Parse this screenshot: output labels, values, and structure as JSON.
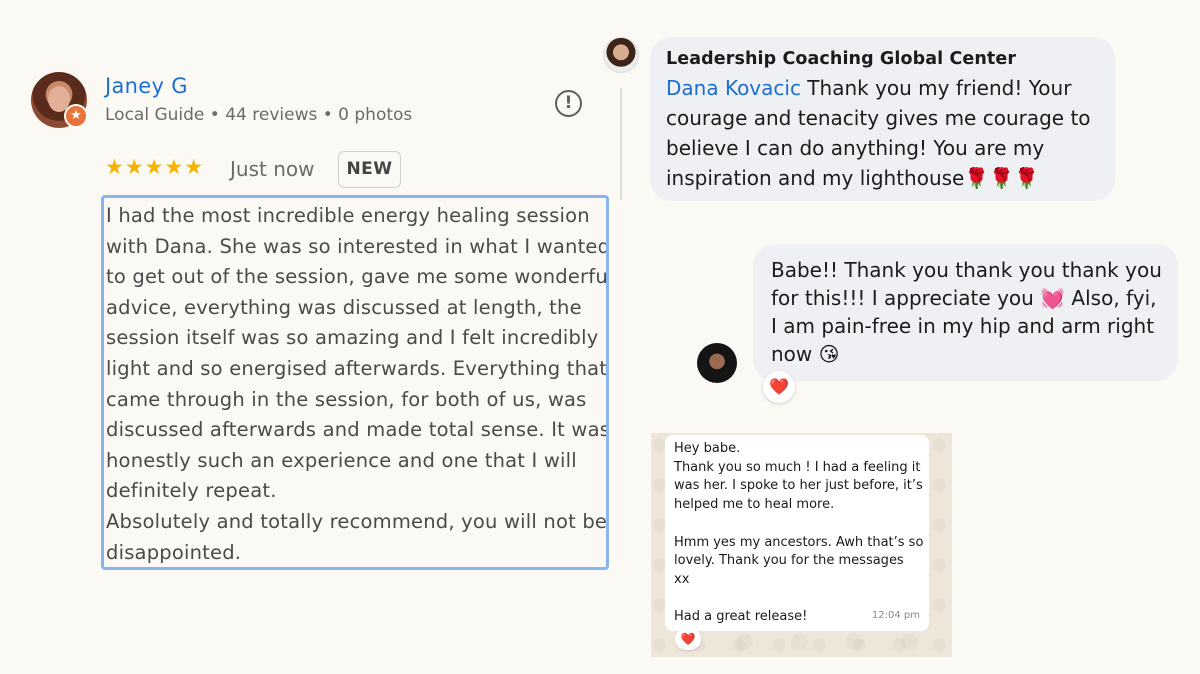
{
  "google_review": {
    "reviewer_name": "Janey G",
    "reviewer_meta": "Local Guide • 44 reviews • 0 photos",
    "guide_badge_icon": "star-icon",
    "report_icon": "report-flag-icon",
    "rating": 5,
    "stars": "★★★★★",
    "time": "Just now",
    "badge": "NEW",
    "body_lines": [
      "I had the most incredible energy healing session",
      "with Dana. She was so interested in what I wanted",
      "to get out of the session, gave me some wonderful",
      "advice, everything was discussed at length, the",
      "session itself was so amazing and I felt incredibly",
      "light and so energised afterwards. Everything that",
      "came through in the session, for both of us, was",
      "discussed afterwards and made total sense. It was",
      "honestly such an experience and one that I will",
      "definitely repeat.",
      "Absolutely and totally recommend, you will not be",
      "disappointed."
    ],
    "colors": {
      "name": "#1f6fd1",
      "stars": "#f6b400",
      "selection_border": "#8ab4ef"
    }
  },
  "fb_comment_1": {
    "author": "Leadership Coaching Global Center",
    "mention": "Dana Kovacic",
    "text_first_line_rest": " Thank you my friend! Your",
    "text_lines": [
      "courage and tenacity gives me courage to",
      "believe I can do anything! You are my",
      "inspiration and my lighthouse🌹🌹🌹"
    ]
  },
  "fb_comment_2": {
    "text_lines": [
      "Babe!! Thank you thank you thank you",
      "for this!!! I appreciate you 💓 Also, fyi,",
      "I am pain-free in my hip and arm right",
      "now 😘"
    ],
    "reaction": "❤️"
  },
  "whatsapp_message": {
    "lines": [
      "Hey babe.",
      "Thank you so much ! I had a feeling it",
      "was her. I spoke to her just before, it’s",
      "helped me to heal more.",
      "",
      "Hmm yes my ancestors. Awh that’s so",
      "lovely. Thank you  for the messages",
      "xx",
      "",
      "Had a great release!"
    ],
    "time": "12:04 pm",
    "reaction": "❤️"
  }
}
